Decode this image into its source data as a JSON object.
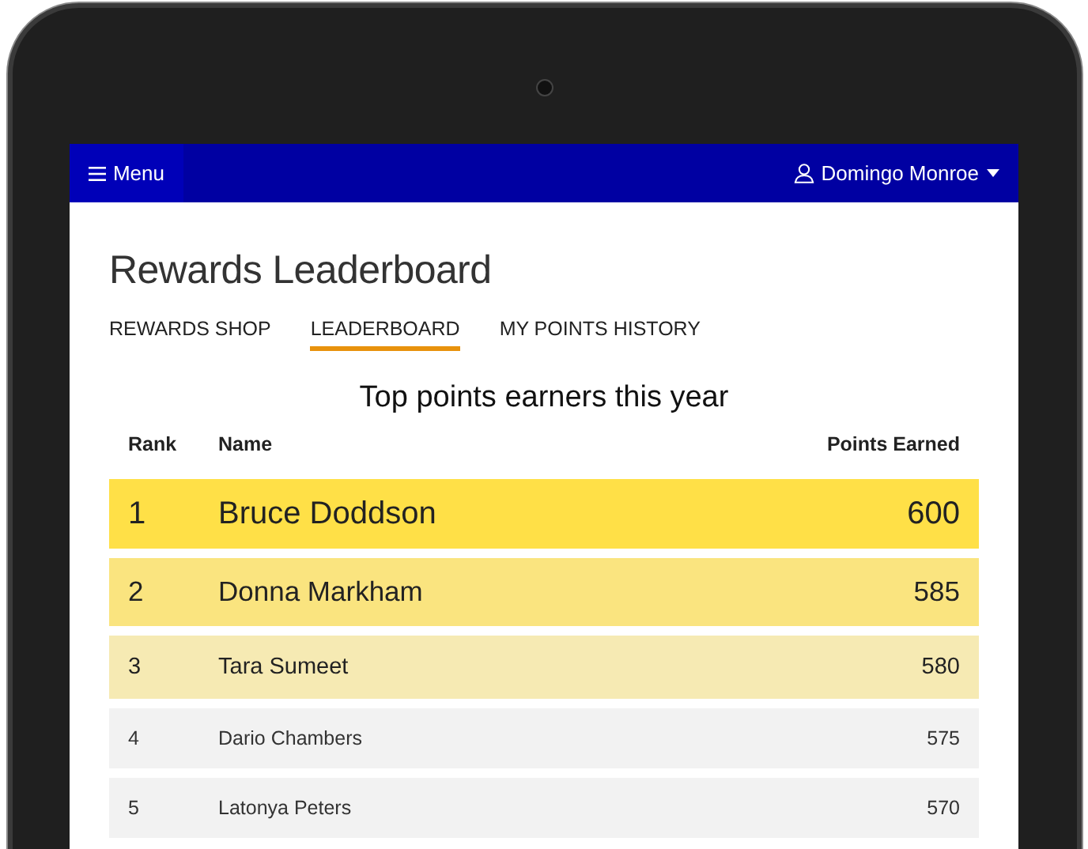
{
  "navbar": {
    "menu_label": "Menu",
    "user_name": "Domingo Monroe"
  },
  "page_title": "Rewards Leaderboard",
  "tabs": [
    {
      "label": "REWARDS SHOP",
      "selected": false
    },
    {
      "label": "LEADERBOARD",
      "selected": true
    },
    {
      "label": "MY POINTS HISTORY",
      "selected": false
    }
  ],
  "leaderboard": {
    "title": "Top points earners this year",
    "columns": [
      "Rank",
      "Name",
      "Points Earned"
    ],
    "rows": [
      {
        "kind": "first",
        "rank": "1",
        "name": "Bruce Doddson",
        "points": "600"
      },
      {
        "kind": "second",
        "rank": "2",
        "name": "Donna Markham",
        "points": "585"
      },
      {
        "kind": "third",
        "rank": "3",
        "name": "Tara Sumeet",
        "points": "580"
      },
      {
        "kind": "regular",
        "rank": "4",
        "name": "Dario Chambers",
        "points": "575"
      },
      {
        "kind": "regular",
        "rank": "5",
        "name": "Latonya Peters",
        "points": "570"
      }
    ]
  }
}
